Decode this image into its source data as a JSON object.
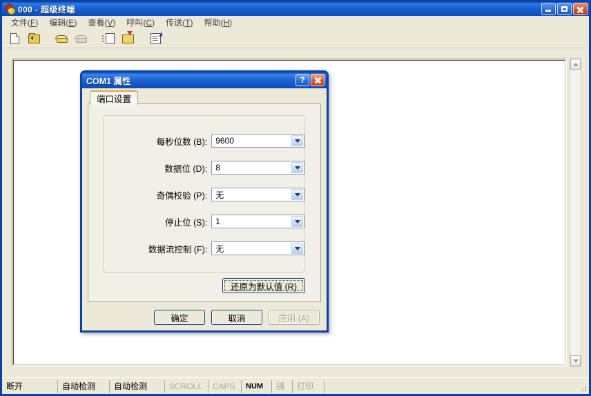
{
  "window": {
    "title": "000 - 超级终端",
    "icon": "hyperterminal-icon",
    "controls": {
      "minimize": "_",
      "maximize": "□",
      "close": "✕"
    }
  },
  "menubar": {
    "items": [
      {
        "label": "文件",
        "mnemonic": "F"
      },
      {
        "label": "编辑",
        "mnemonic": "E"
      },
      {
        "label": "查看",
        "mnemonic": "V"
      },
      {
        "label": "呼叫",
        "mnemonic": "C"
      },
      {
        "label": "传送",
        "mnemonic": "T"
      },
      {
        "label": "帮助",
        "mnemonic": "H"
      }
    ]
  },
  "toolbar": {
    "buttons": [
      {
        "name": "new-connection-icon"
      },
      {
        "name": "open-folder-icon"
      },
      {
        "name": "call-icon"
      },
      {
        "name": "disconnect-icon"
      },
      {
        "name": "send-file-icon"
      },
      {
        "name": "receive-file-icon"
      },
      {
        "name": "properties-icon"
      }
    ]
  },
  "dialog": {
    "title": "COM1 属性",
    "help_label": "?",
    "close_label": "✕",
    "tab": {
      "label": "端口设置"
    },
    "fields": [
      {
        "label": "每秒位数 (B):",
        "mnemonic": "B",
        "value": "9600"
      },
      {
        "label": "数据位 (D):",
        "mnemonic": "D",
        "value": "8"
      },
      {
        "label": "奇偶校验 (P):",
        "mnemonic": "P",
        "value": "无"
      },
      {
        "label": "停止位 (S):",
        "mnemonic": "S",
        "value": "1"
      },
      {
        "label": "数据流控制 (F):",
        "mnemonic": "F",
        "value": "无"
      }
    ],
    "restore_button": "还原为默认值 (R)",
    "footer_buttons": [
      {
        "label": "确定",
        "enabled": true
      },
      {
        "label": "取消",
        "enabled": true
      },
      {
        "label": "应用 (A)",
        "enabled": false
      }
    ]
  },
  "statusbar": {
    "cells": [
      {
        "label": "断开",
        "dim": false
      },
      {
        "label": "自动检测",
        "dim": false
      },
      {
        "label": "自动检测",
        "dim": false
      },
      {
        "label": "SCROLL",
        "dim": true
      },
      {
        "label": "CAPS",
        "dim": true
      },
      {
        "label": "NUM",
        "dim": false
      },
      {
        "label": "捕",
        "dim": true
      },
      {
        "label": "打印",
        "dim": true
      }
    ]
  },
  "colors": {
    "titlebar_blue": "#1a5fd0",
    "window_face": "#ece9d8",
    "dialog_border": "#0a42a5",
    "tab_accent": "#e8a33d",
    "terminal_bg": "#ffffff"
  }
}
